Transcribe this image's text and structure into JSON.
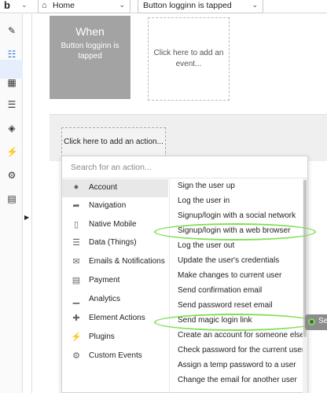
{
  "topbar": {
    "brand": "b",
    "page_select": {
      "value": "Home"
    },
    "event_select": {
      "value": "Button logginn is tapped"
    }
  },
  "rail": {
    "icons": [
      "pencil-icon",
      "workflow-icon",
      "data-icon",
      "database-icon",
      "palette-icon",
      "plugin-icon",
      "settings-icon",
      "logs-icon"
    ],
    "active": "workflow-icon"
  },
  "canvas": {
    "when_card": {
      "title": "When",
      "subtitle": "Button logginn is tapped"
    },
    "add_event": "Click here to add an event...",
    "add_action": "Click here to add an action..."
  },
  "dropdown": {
    "search_placeholder": "Search for an action...",
    "categories": [
      {
        "label": "Account",
        "icon": "user-icon",
        "selected": true
      },
      {
        "label": "Navigation",
        "icon": "navigation-icon",
        "selected": false
      },
      {
        "label": "Native Mobile",
        "icon": "mobile-icon",
        "selected": false
      },
      {
        "label": "Data (Things)",
        "icon": "database-icon",
        "selected": false
      },
      {
        "label": "Emails & Notifications",
        "icon": "mail-icon",
        "selected": false
      },
      {
        "label": "Payment",
        "icon": "card-icon",
        "selected": false
      },
      {
        "label": "Analytics",
        "icon": "chart-icon",
        "selected": false
      },
      {
        "label": "Element Actions",
        "icon": "element-icon",
        "selected": false
      },
      {
        "label": "Plugins",
        "icon": "plugin-icon",
        "selected": false
      },
      {
        "label": "Custom Events",
        "icon": "gears-icon",
        "selected": false
      }
    ],
    "actions": [
      "Sign the user up",
      "Log the user in",
      "Signup/login with a social network",
      "Signup/login with a web browser",
      "Log the user out",
      "Update the user's credentials",
      "Make changes to current user",
      "Send confirmation email",
      "Send password reset email",
      "Send magic login link",
      "Create an account for someone else",
      "Check password for the current user",
      "Assign a temp password to a user",
      "Change the email for another user"
    ],
    "highlighted": [
      "Signup/login with a web browser",
      "Send magic login link"
    ]
  },
  "side_tip": "Se",
  "colors": {
    "highlight": "#7ee052",
    "accent": "#1a73e8",
    "card": "#a3a3a3"
  }
}
